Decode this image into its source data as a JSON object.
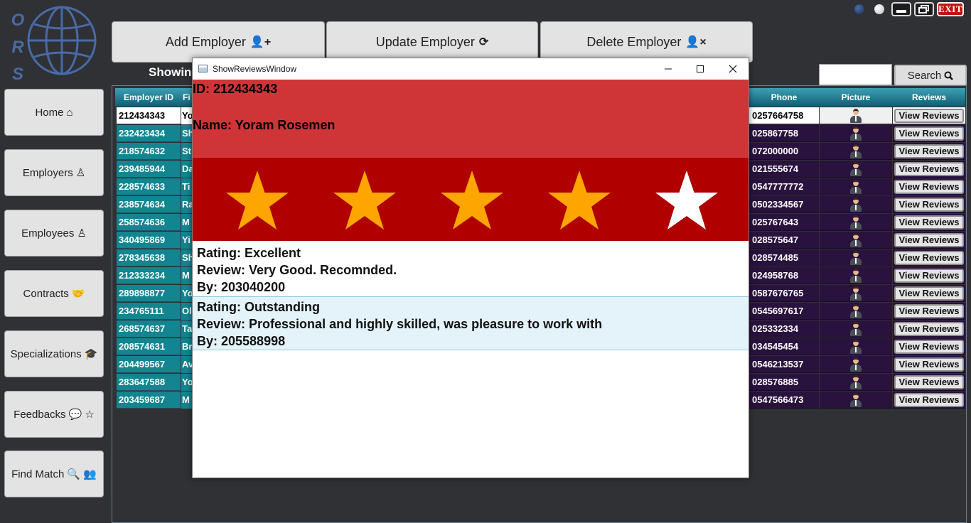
{
  "logo": {
    "letters": [
      "O",
      "R",
      "S"
    ]
  },
  "window_controls": {
    "exit_label": "EXIT"
  },
  "top_buttons": [
    {
      "label": "Add Employer",
      "icon": "user-plus-icon",
      "glyph": "👤+"
    },
    {
      "label": "Update Employer",
      "icon": "refresh-icon",
      "glyph": "⟳"
    },
    {
      "label": "Delete Employer",
      "icon": "user-times-icon",
      "glyph": "👤×"
    }
  ],
  "showing_label": "Showin",
  "search": {
    "value": "",
    "button_label": "Search"
  },
  "sidebar": [
    {
      "label": "Home",
      "icon": "home-icon",
      "glyph": "⌂"
    },
    {
      "label": "Employers",
      "icon": "user-icon",
      "glyph": "♙"
    },
    {
      "label": "Employees",
      "icon": "user-icon",
      "glyph": "♙"
    },
    {
      "label": "Contracts",
      "icon": "handshake-icon",
      "glyph": "🤝"
    },
    {
      "label": "Specializations",
      "icon": "graduation-cap-icon",
      "glyph": "🎓"
    },
    {
      "label": "Feedbacks",
      "icon": "comment-star-icon",
      "glyph": "💬 ☆"
    },
    {
      "label": "Find Match",
      "icon": "search-users-icon",
      "glyph": "🔍 👥"
    }
  ],
  "grid": {
    "headers": {
      "id": "Employer ID",
      "first": "Fi",
      "phone": "Phone",
      "picture": "Picture",
      "reviews": "Reviews"
    },
    "button_label": "View Reviews",
    "rows": [
      {
        "id": "212434343",
        "first": "Yo",
        "phone": "0257664758",
        "selected": true
      },
      {
        "id": "232423434",
        "first": "Sh",
        "phone": "025867758"
      },
      {
        "id": "218574632",
        "first": "St",
        "phone": "072000000"
      },
      {
        "id": "239485944",
        "first": "Da",
        "phone": "021555674"
      },
      {
        "id": "228574633",
        "first": "Ti",
        "phone": "0547777772"
      },
      {
        "id": "238574634",
        "first": "Ra",
        "phone": "0502334567"
      },
      {
        "id": "258574636",
        "first": "M",
        "phone": "025767643"
      },
      {
        "id": "340495869",
        "first": "Yi",
        "phone": "028575647"
      },
      {
        "id": "278345638",
        "first": "Sh",
        "phone": "028574485"
      },
      {
        "id": "212333234",
        "first": "M",
        "phone": "024958768"
      },
      {
        "id": "289898877",
        "first": "Yo",
        "phone": "0587676765"
      },
      {
        "id": "234765111",
        "first": "Ol",
        "phone": "0545697617"
      },
      {
        "id": "268574637",
        "first": "Ta",
        "phone": "025332334"
      },
      {
        "id": "208574631",
        "first": "Br",
        "phone": "034545454"
      },
      {
        "id": "204499567",
        "first": "Av",
        "phone": "0546213537"
      },
      {
        "id": "283647588",
        "first": "Yo",
        "phone": "028576885"
      },
      {
        "id": "203459687",
        "first": "M",
        "phone": "0547566473"
      }
    ]
  },
  "modal": {
    "title": "ShowReviewsWindow",
    "id_line": "ID:  212434343",
    "name_line": "Name:  Yoram Rosemen",
    "rating_stars": 4,
    "max_stars": 5,
    "colors": {
      "star_filled": "#ffa500",
      "star_empty": "#ffffff",
      "info_bg": "#cf3537",
      "stars_bg": "#b00000"
    },
    "reviews": [
      {
        "rating": "Rating: Excellent",
        "review": "Review: Very Good. Recomnded.",
        "by": "By: 203040200"
      },
      {
        "rating": "Rating: Outstanding",
        "review": "Review: Professional and highly skilled, was pleasure to work with",
        "by": "By: 205588998"
      }
    ]
  }
}
